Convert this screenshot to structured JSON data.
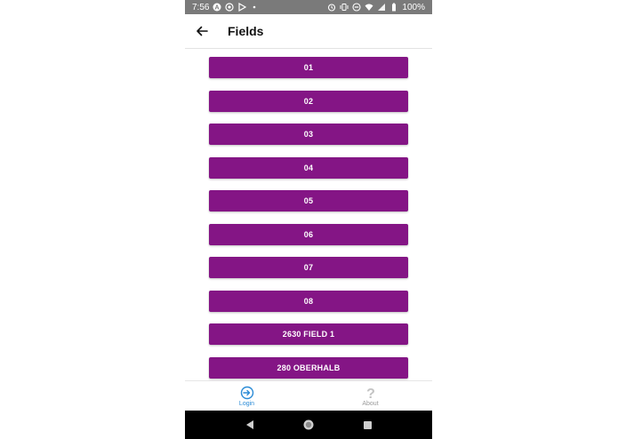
{
  "status_bar": {
    "time": "7:56",
    "battery": "100%",
    "left_icons": [
      "a-circle-icon",
      "sync-icon",
      "play-store-icon",
      "dot-icon"
    ],
    "right_icons": [
      "alarm-icon",
      "vibrate-icon",
      "dnd-icon",
      "wifi-icon",
      "signal-icon",
      "battery-icon"
    ]
  },
  "app_bar": {
    "title": "Fields",
    "back_icon": "arrow-left-icon"
  },
  "fields": [
    {
      "label": "01"
    },
    {
      "label": "02"
    },
    {
      "label": "03"
    },
    {
      "label": "04"
    },
    {
      "label": "05"
    },
    {
      "label": "06"
    },
    {
      "label": "07"
    },
    {
      "label": "08"
    },
    {
      "label": "2630 FIELD 1"
    },
    {
      "label": "280 OBERHALB"
    }
  ],
  "tabs": [
    {
      "label": "Login",
      "icon": "login-icon",
      "active": true
    },
    {
      "label": "About",
      "icon": "question-icon",
      "active": false
    }
  ],
  "colors": {
    "button": "#841585",
    "status_bar": "#7a7a7a",
    "active_tab": "#2a8bd6",
    "inactive_tab": "#9a9a9a"
  },
  "nav_bar": [
    "back-triangle-icon",
    "home-circle-icon",
    "recents-square-icon"
  ]
}
